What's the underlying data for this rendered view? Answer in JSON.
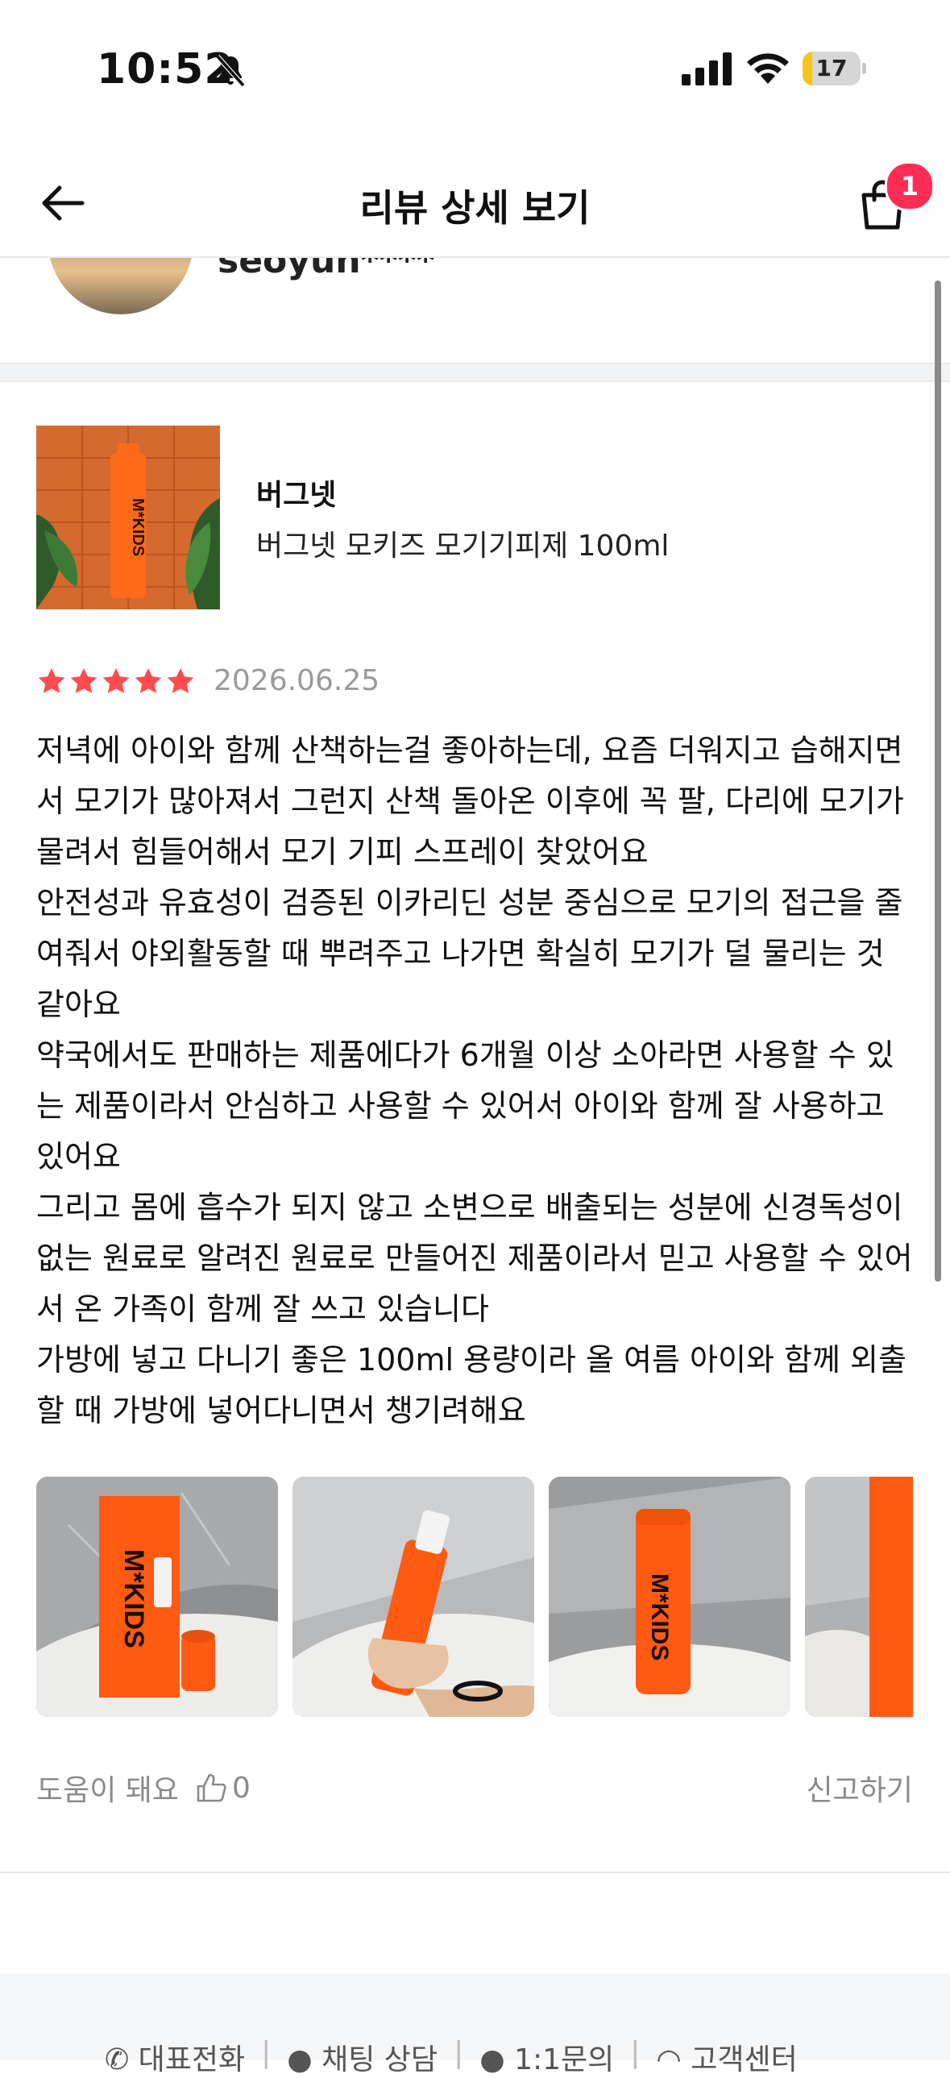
{
  "status_bar": {
    "time": "10:52",
    "battery": "17",
    "battery_level": 0.17
  },
  "header": {
    "title": "리뷰 상세 보기",
    "cart_count": "1"
  },
  "reviewer": {
    "username": "seoyun****"
  },
  "product": {
    "brand": "버그넷",
    "name": "버그넷 모키즈 모기기피제 100ml"
  },
  "review": {
    "rating": 5,
    "date": "2026.06.25",
    "paragraphs": [
      "저녁에 아이와 함께 산책하는걸 좋아하는데, 요즘 더워지고 습해지면서 모기가 많아져서 그런지 산책 돌아온 이후에 꼭 팔, 다리에 모기가 물려서 힘들어해서 모기 기피 스프레이 찾았어요",
      "안전성과 유효성이 검증된 이카리딘 성분 중심으로 모기의 접근을 줄여줘서 야외활동할 때 뿌려주고 나가면 확실히 모기가 덜 물리는 것 같아요",
      "약국에서도 판매하는 제품에다가 6개월 이상 소아라면 사용할 수 있는 제품이라서 안심하고 사용할 수 있어서 아이와 함께 잘 사용하고 있어요",
      "그리고 몸에 흡수가 되지 않고 소변으로 배출되는 성분에 신경독성이 없는 원료로 알려진 원료로 만들어진 제품이라서 믿고 사용할 수 있어서 온 가족이 함께 잘 쓰고 있습니다",
      "가방에 넣고 다니기 좋은 100ml 용량이라 올 여름 아이와 함께 외출할 때 가방에 넣어다니면서 챙기려해요"
    ],
    "helpful_label": "도움이 돼요",
    "helpful_count": "0",
    "report_label": "신고하기"
  },
  "footer": {
    "links": [
      "대표전화",
      "채팅 상담",
      "1:1문의",
      "고객센터"
    ]
  },
  "colors": {
    "star": "#ff4d4f",
    "accent_orange": "#ff5a12",
    "badge": "#ff2d55"
  }
}
